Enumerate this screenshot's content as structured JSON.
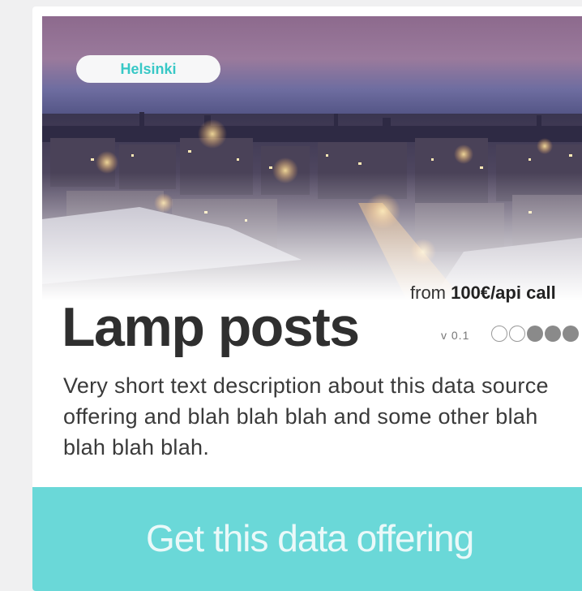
{
  "card": {
    "location_tag": "Helsinki",
    "title": "Lamp posts",
    "price_prefix": "from ",
    "price_value": "100€/api call",
    "version": "v 0.1",
    "rating": {
      "value": 3,
      "max": 5
    },
    "description": "Very short text description about this data source offering and blah blah blah and some other blah blah blah blah.",
    "cta_label": "Get this data offering"
  },
  "colors": {
    "accent": "#6ad8d8",
    "tag_text": "#38c8c6",
    "title": "#2f2f2f"
  },
  "hero_image": {
    "subject": "night city skyline photo"
  }
}
